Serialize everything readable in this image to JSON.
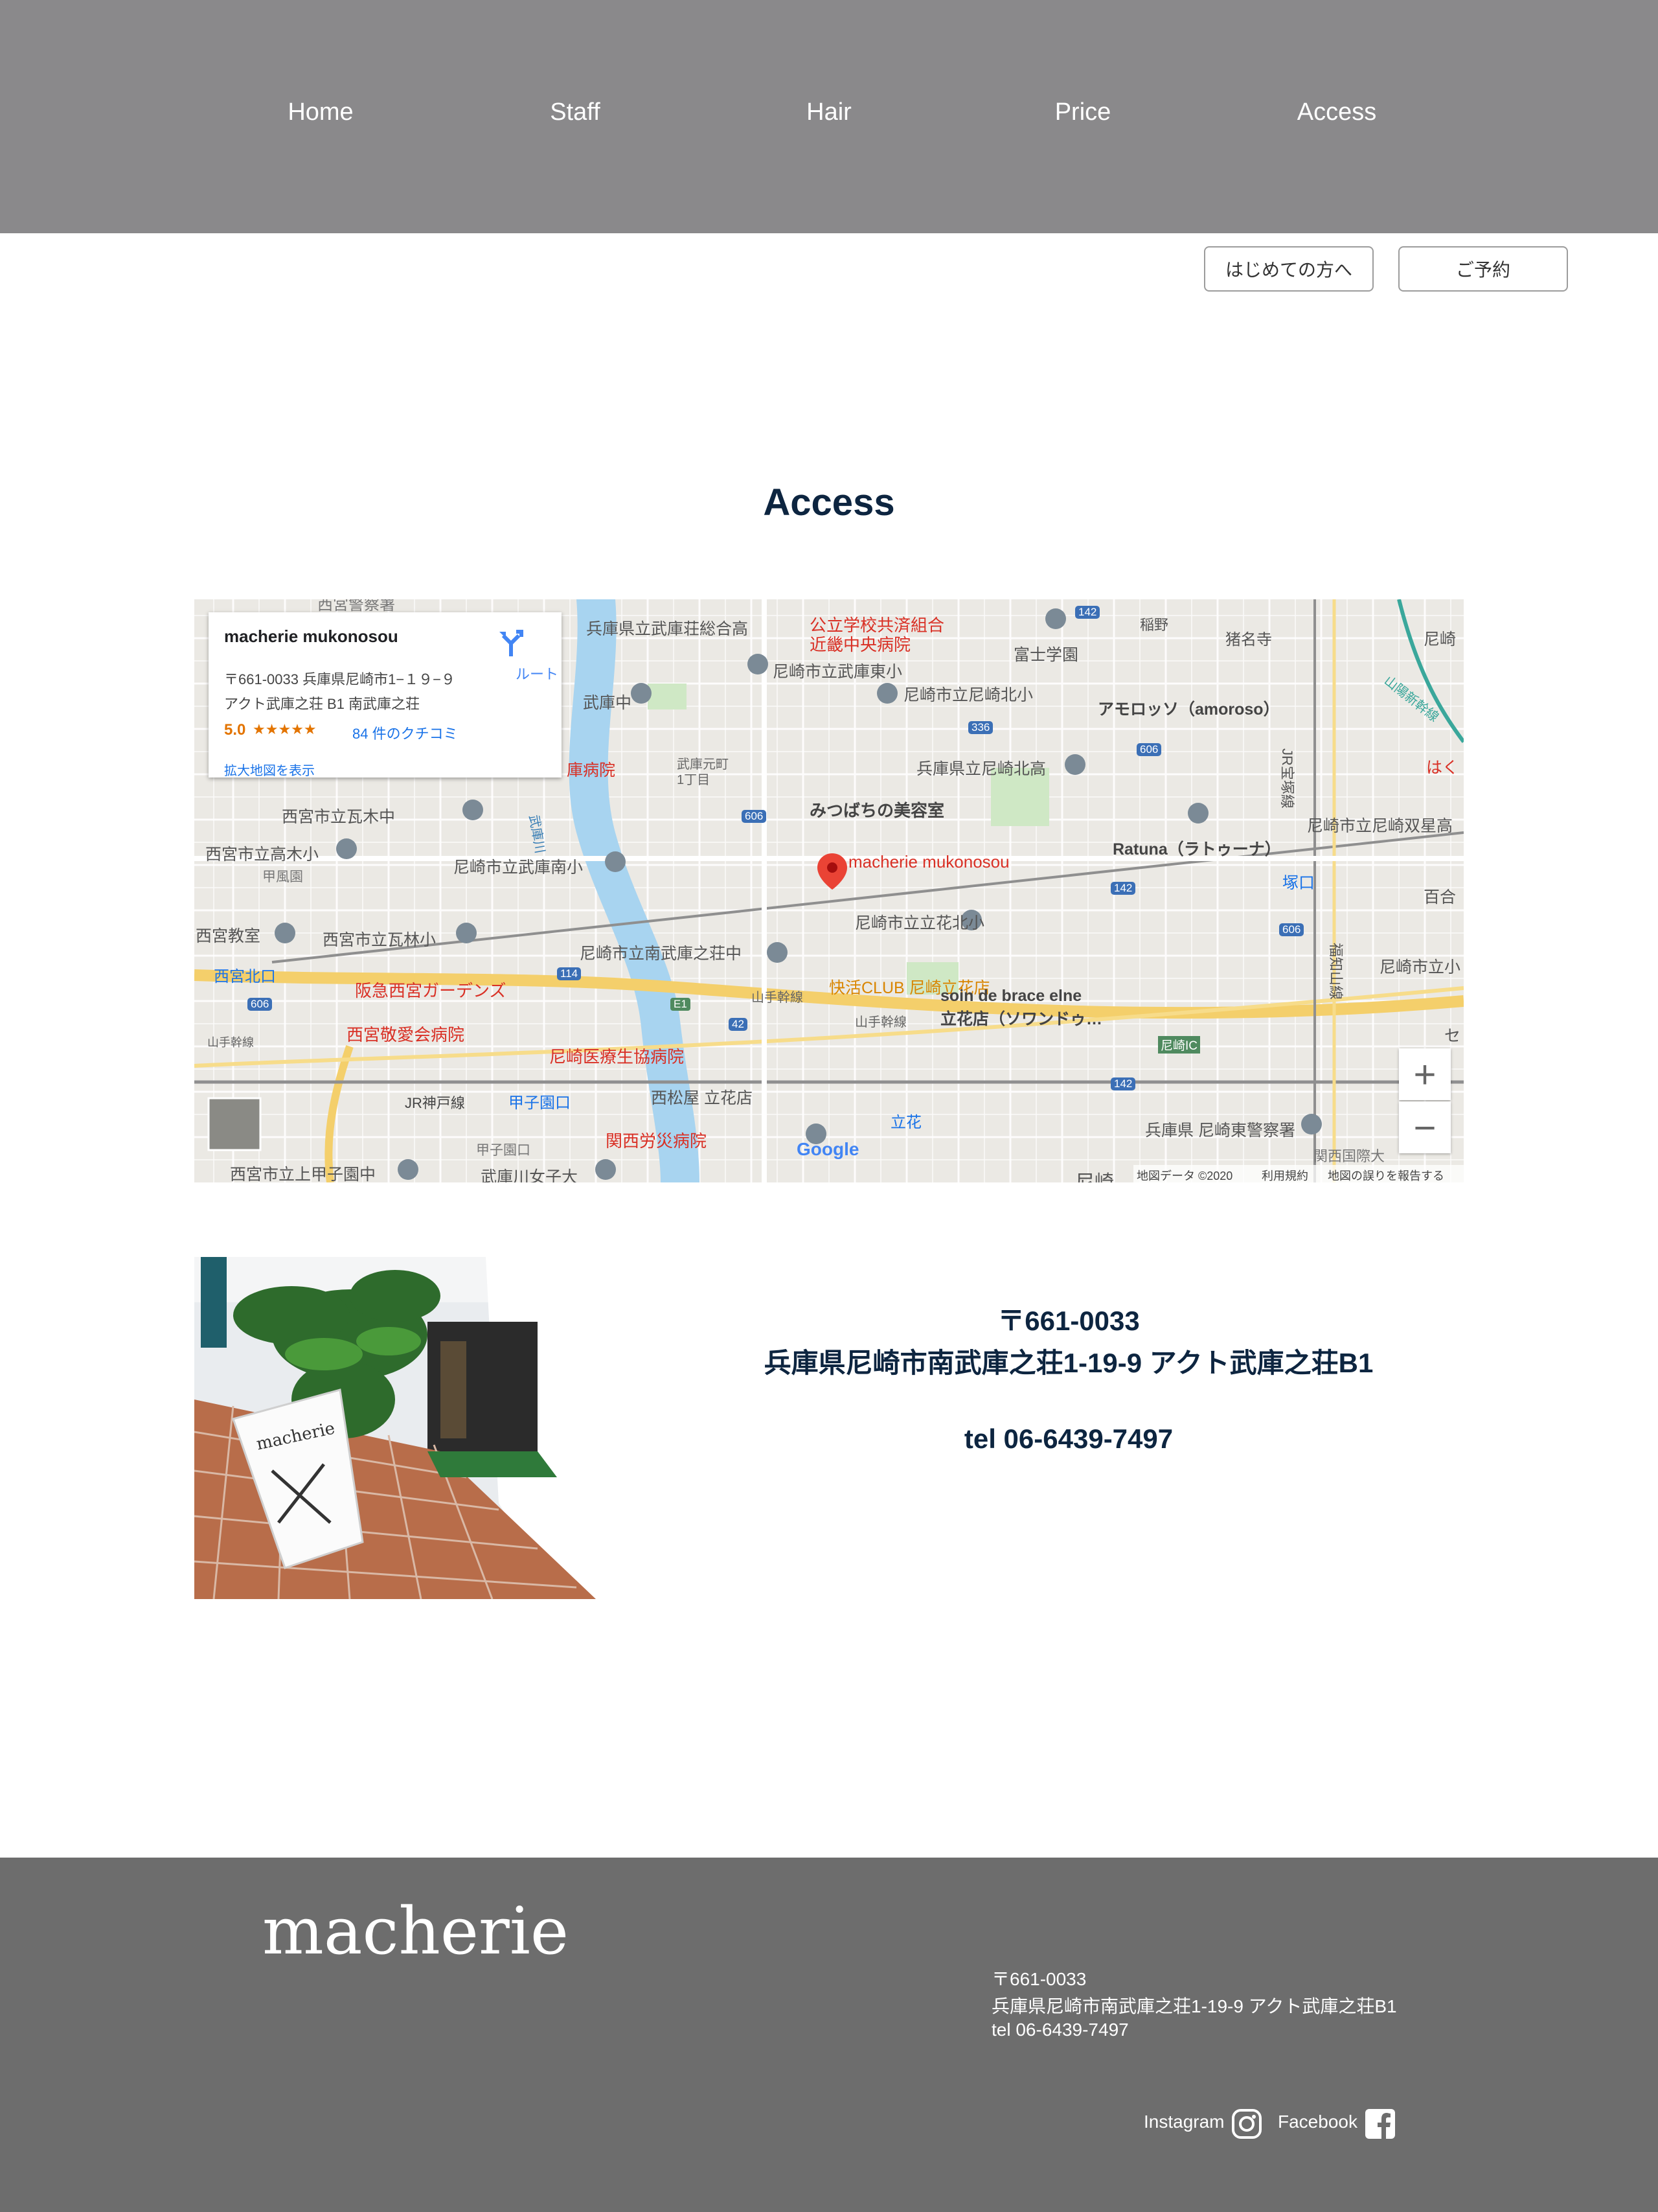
{
  "nav": {
    "items": [
      {
        "label": "Home"
      },
      {
        "label": "Staff"
      },
      {
        "label": "Hair"
      },
      {
        "label": "Price"
      },
      {
        "label": "Access"
      }
    ]
  },
  "header_buttons": {
    "first_time": "はじめての方へ",
    "reserve": "ご予約"
  },
  "page_title": "Access",
  "map": {
    "card": {
      "name": "macherie mukonosou",
      "address_line1": "〒661-0033 兵庫県尼崎市1−１９−９",
      "address_line2": "アクト武庫之荘 B1 南武庫之荘",
      "rating": "5.0",
      "stars": "★★★★★",
      "reviews": "84 件のクチコミ",
      "enlarge": "拡大地図を表示",
      "route": "ルート"
    },
    "pin_label": "macherie mukonosou",
    "attribution": {
      "data": "地図データ ©2020",
      "terms": "利用規約",
      "report": "地図の誤りを報告する",
      "google": "Google"
    },
    "zoom_in": "+",
    "zoom_out": "−",
    "labels": [
      {
        "text": "兵庫県立武庫荘総合高"
      },
      {
        "text": "公立学校共済組合"
      },
      {
        "text": "近畿中央病院"
      },
      {
        "text": "尼崎市立武庫東小"
      },
      {
        "text": "富士学園"
      },
      {
        "text": "稲野"
      },
      {
        "text": "猪名寺"
      },
      {
        "text": "尼崎市立尼崎北小"
      },
      {
        "text": "アモロッソ（amoroso）"
      },
      {
        "text": "武庫中"
      },
      {
        "text": "武庫元町"
      },
      {
        "text": "1丁目"
      },
      {
        "text": "兵庫県立尼崎北高"
      },
      {
        "text": "庫病院"
      },
      {
        "text": "みつばちの美容室"
      },
      {
        "text": "西宮市立瓦木中"
      },
      {
        "text": "西宮市立高木小"
      },
      {
        "text": "甲風園"
      },
      {
        "text": "尼崎市立武庫南小"
      },
      {
        "text": "Ratuna（ラトゥーナ）"
      },
      {
        "text": "尼崎市立尼崎双星高"
      },
      {
        "text": "塚口"
      },
      {
        "text": "西宮教室"
      },
      {
        "text": "西宮市立瓦林小"
      },
      {
        "text": "尼崎市立南武庫之荘中"
      },
      {
        "text": "尼崎市立立花北小"
      },
      {
        "text": "西宮北口"
      },
      {
        "text": "阪急西宮ガーデンズ"
      },
      {
        "text": "快活CLUB 尼崎立花店"
      },
      {
        "text": "尼崎市立小"
      },
      {
        "text": "山手幹線"
      },
      {
        "text": "西宮敬愛会病院"
      },
      {
        "text": "soin de brace elne"
      },
      {
        "text": "立花店（ソワンドゥ…"
      },
      {
        "text": "尼崎IC"
      },
      {
        "text": "尼崎医療生協病院"
      },
      {
        "text": "JR神戸線"
      },
      {
        "text": "甲子園口"
      },
      {
        "text": "西松屋 立花店"
      },
      {
        "text": "甲子園口"
      },
      {
        "text": "関西労災病院"
      },
      {
        "text": "立花"
      },
      {
        "text": "兵庫県 尼崎東警察署"
      },
      {
        "text": "西宮市立上甲子園中"
      },
      {
        "text": "武庫川女子大"
      },
      {
        "text": "関西国際大"
      },
      {
        "text": "西宮警察署"
      },
      {
        "text": "山手幹線"
      },
      {
        "text": "JR宝塚線"
      },
      {
        "text": "福知山線"
      },
      {
        "text": "山陽新幹線"
      },
      {
        "text": "武庫川"
      },
      {
        "text": "山手幹線"
      },
      {
        "text": "尼崎"
      },
      {
        "text": "百合"
      },
      {
        "text": "セ"
      },
      {
        "text": "はく"
      },
      {
        "text": "尼崎"
      }
    ],
    "road_numbers": [
      "142",
      "336",
      "606",
      "606",
      "114",
      "42",
      "142",
      "606",
      "142",
      "E1",
      "606"
    ]
  },
  "contact": {
    "postal": "〒661-0033",
    "address": "兵庫県尼崎市南武庫之荘1-19-9 アクト武庫之荘B1",
    "tel": "tel 06-6439-7497"
  },
  "photo": {
    "sign_text": "macherie"
  },
  "footer": {
    "logo": "macherie",
    "postal": "〒661-0033",
    "address": "兵庫県尼崎市南武庫之荘1-19-9 アクト武庫之荘B1",
    "tel": "tel 06-6439-7497",
    "instagram": "Instagram",
    "facebook": "Facebook"
  },
  "colors": {
    "nav_bg": "#8a898b",
    "footer_bg": "#6d6d6d",
    "title": "#0d2540",
    "pin": "#ea4335"
  }
}
